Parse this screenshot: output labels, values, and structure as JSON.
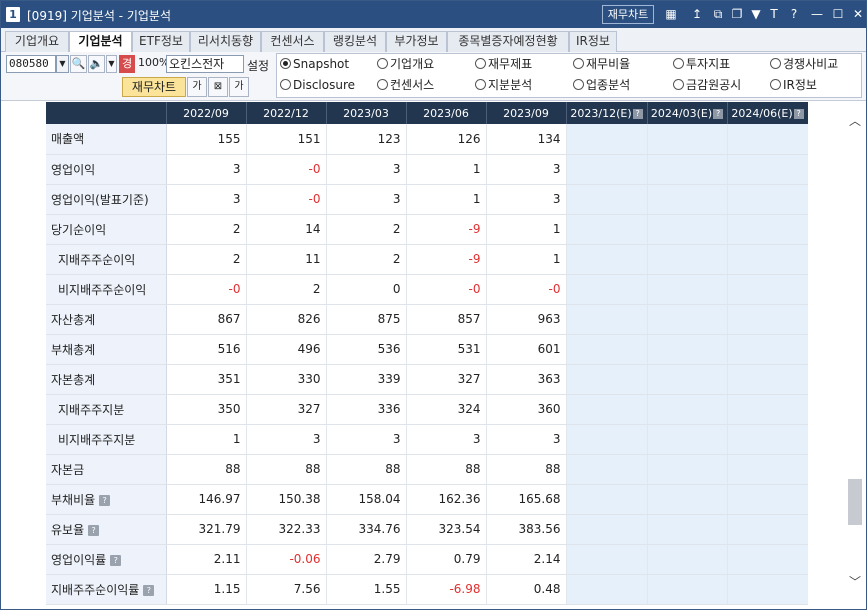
{
  "window": {
    "number": "1",
    "title": "[0919] 기업분석 - 기업분석",
    "chip_label": "재무차트",
    "icons": [
      "chart-icon",
      "pin-icon",
      "window-icon",
      "layers-icon",
      "marker-icon",
      "text-size-icon",
      "help-icon",
      "minimize-icon",
      "maximize-icon",
      "close-icon"
    ],
    "icon_glyphs": [
      "▦",
      "↥",
      "⧉",
      "❐",
      "▼",
      "T",
      "?",
      "—",
      "☐",
      "✕"
    ]
  },
  "tabs": [
    "기업개요",
    "기업분석",
    "ETF정보",
    "리서치동향",
    "컨센서스",
    "랭킹분석",
    "부가정보",
    "종목별증자예정현황",
    "IR정보"
  ],
  "active_tab": "기업분석",
  "controls": {
    "stock_code": "080580",
    "red_badge": "경",
    "percent": "100%",
    "company": "오킨스전자",
    "settings_label": "설정",
    "fin_chart_label": "재무차트",
    "small_btn1": "가",
    "small_btn2": "⊠",
    "small_btn3": "가"
  },
  "radios": [
    {
      "label": "Snapshot",
      "selected": true
    },
    {
      "label": "기업개요",
      "selected": false
    },
    {
      "label": "재무제표",
      "selected": false
    },
    {
      "label": "재무비율",
      "selected": false
    },
    {
      "label": "투자지표",
      "selected": false
    },
    {
      "label": "경쟁사비교",
      "selected": false
    },
    {
      "label": "Disclosure",
      "selected": false
    },
    {
      "label": "컨센서스",
      "selected": false
    },
    {
      "label": "지분분석",
      "selected": false
    },
    {
      "label": "업종분석",
      "selected": false
    },
    {
      "label": "금감원공시",
      "selected": false
    },
    {
      "label": "IR정보",
      "selected": false
    }
  ],
  "table": {
    "columns": [
      "2022/09",
      "2022/12",
      "2023/03",
      "2023/06",
      "2023/09",
      "2023/12(E)",
      "2024/03(E)",
      "2024/06(E)"
    ],
    "estimate_flags": [
      false,
      false,
      false,
      false,
      false,
      true,
      true,
      true
    ],
    "rows": [
      {
        "label": "매출액",
        "indent": false,
        "help": false,
        "values": [
          "155",
          "151",
          "123",
          "126",
          "134",
          "",
          "",
          ""
        ]
      },
      {
        "label": "영업이익",
        "indent": false,
        "help": false,
        "values": [
          "3",
          "-0",
          "3",
          "1",
          "3",
          "",
          "",
          ""
        ]
      },
      {
        "label": "영업이익(발표기준)",
        "indent": false,
        "help": false,
        "values": [
          "3",
          "-0",
          "3",
          "1",
          "3",
          "",
          "",
          ""
        ]
      },
      {
        "label": "당기순이익",
        "indent": false,
        "help": false,
        "values": [
          "2",
          "14",
          "2",
          "-9",
          "1",
          "",
          "",
          ""
        ]
      },
      {
        "label": "지배주주순이익",
        "indent": true,
        "help": false,
        "values": [
          "2",
          "11",
          "2",
          "-9",
          "1",
          "",
          "",
          ""
        ]
      },
      {
        "label": "비지배주주순이익",
        "indent": true,
        "help": false,
        "values": [
          "-0",
          "2",
          "0",
          "-0",
          "-0",
          "",
          "",
          ""
        ]
      },
      {
        "label": "자산총계",
        "indent": false,
        "help": false,
        "values": [
          "867",
          "826",
          "875",
          "857",
          "963",
          "",
          "",
          ""
        ]
      },
      {
        "label": "부채총계",
        "indent": false,
        "help": false,
        "values": [
          "516",
          "496",
          "536",
          "531",
          "601",
          "",
          "",
          ""
        ]
      },
      {
        "label": "자본총계",
        "indent": false,
        "help": false,
        "values": [
          "351",
          "330",
          "339",
          "327",
          "363",
          "",
          "",
          ""
        ]
      },
      {
        "label": "지배주주지분",
        "indent": true,
        "help": false,
        "values": [
          "350",
          "327",
          "336",
          "324",
          "360",
          "",
          "",
          ""
        ]
      },
      {
        "label": "비지배주주지분",
        "indent": true,
        "help": false,
        "values": [
          "1",
          "3",
          "3",
          "3",
          "3",
          "",
          "",
          ""
        ]
      },
      {
        "label": "자본금",
        "indent": false,
        "help": false,
        "values": [
          "88",
          "88",
          "88",
          "88",
          "88",
          "",
          "",
          ""
        ]
      },
      {
        "label": "부채비율",
        "indent": false,
        "help": true,
        "values": [
          "146.97",
          "150.38",
          "158.04",
          "162.36",
          "165.68",
          "",
          "",
          ""
        ]
      },
      {
        "label": "유보율",
        "indent": false,
        "help": true,
        "values": [
          "321.79",
          "322.33",
          "334.76",
          "323.54",
          "383.56",
          "",
          "",
          ""
        ]
      },
      {
        "label": "영업이익률",
        "indent": false,
        "help": true,
        "values": [
          "2.11",
          "-0.06",
          "2.79",
          "0.79",
          "2.14",
          "",
          "",
          ""
        ]
      },
      {
        "label": "지배주주순이익률",
        "indent": false,
        "help": true,
        "values": [
          "1.15",
          "7.56",
          "1.55",
          "-6.98",
          "0.48",
          "",
          "",
          ""
        ]
      }
    ]
  },
  "colors": {
    "negative": "#e0302f",
    "header_bg": "#23364f",
    "estimate_bg": "#e5f0fa",
    "title_bg": "#2b4f80"
  }
}
